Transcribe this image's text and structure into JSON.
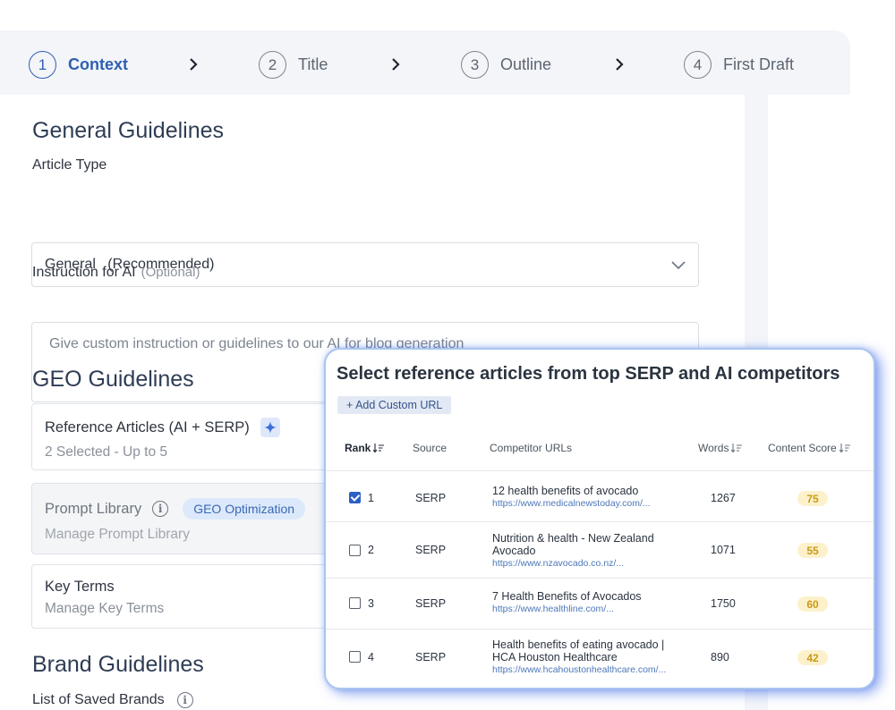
{
  "stepper": [
    {
      "num": "1",
      "label": "Context",
      "active": true
    },
    {
      "num": "2",
      "label": "Title",
      "active": false
    },
    {
      "num": "3",
      "label": "Outline",
      "active": false
    },
    {
      "num": "4",
      "label": "First Draft",
      "active": false
    }
  ],
  "general": {
    "heading": "General Guidelines",
    "article_type_label": "Article Type",
    "article_type_value": "General   (Recommended)",
    "instruction_label": "Instruction for AI",
    "instruction_optional": "(Optional)",
    "instruction_placeholder": "Give custom instruction or guidelines to our AI for blog generation"
  },
  "geo": {
    "heading": "GEO Guidelines",
    "reference_title": "Reference Articles (AI + SERP)",
    "reference_sub": "2 Selected - Up to 5",
    "prompt_title": "Prompt Library",
    "prompt_badge": "GEO Optimization",
    "prompt_sub": "Manage Prompt Library",
    "keyterms_title": "Key Terms",
    "keyterms_sub": "Manage Key Terms"
  },
  "brand": {
    "heading": "Brand Guidelines",
    "saved_label": "List of Saved Brands"
  },
  "modal": {
    "title": "Select reference articles from top SERP and AI competitors",
    "add_url": "+ Add Custom URL",
    "columns": {
      "rank": "Rank",
      "source": "Source",
      "urls": "Competitor URLs",
      "words": "Words",
      "score": "Content Score"
    },
    "rows": [
      {
        "checked": true,
        "rank": "1",
        "source": "SERP",
        "title": "12 health benefits of avocado",
        "url": "https://www.medicalnewstoday.com/...",
        "words": "1267",
        "score": "75"
      },
      {
        "checked": false,
        "rank": "2",
        "source": "SERP",
        "title": "Nutrition & health - New Zealand Avocado",
        "url": "https://www.nzavocado.co.nz/...",
        "words": "1071",
        "score": "55"
      },
      {
        "checked": false,
        "rank": "3",
        "source": "SERP",
        "title": "7 Health Benefits of Avocados",
        "url": "https://www.healthline.com/...",
        "words": "1750",
        "score": "60"
      },
      {
        "checked": false,
        "rank": "4",
        "source": "SERP",
        "title": "Health benefits of eating avocado | HCA Houston Healthcare",
        "url": "https://www.hcahoustonhealthcare.com/...",
        "words": "890",
        "score": "42"
      }
    ]
  },
  "colors": {
    "accent": "#2f5fb0",
    "score_bg": "#fdf1cc",
    "score_text": "#c99a14",
    "modal_glow": "#2855e6"
  }
}
